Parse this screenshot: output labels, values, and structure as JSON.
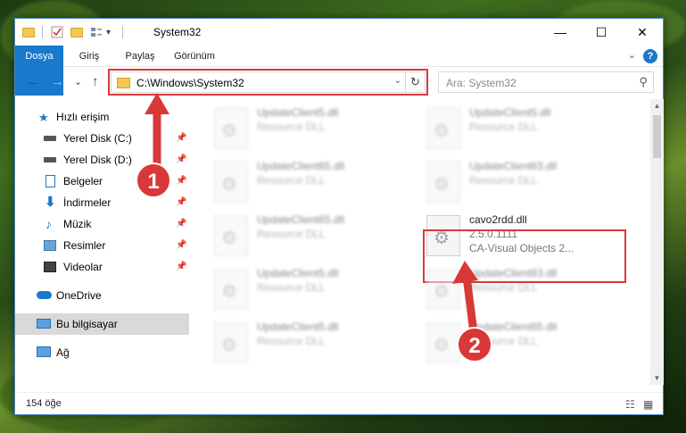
{
  "window": {
    "title": "System32"
  },
  "titlebar": {
    "minimize": "—",
    "maximize": "☐",
    "close": "✕"
  },
  "ribbon": {
    "tabs": [
      "Dosya",
      "Giriş",
      "Paylaş",
      "Görünüm"
    ],
    "help": "?"
  },
  "navigation": {
    "back": "←",
    "forward": "→",
    "recent": "⌄",
    "up": "↑",
    "address": "C:\\Windows\\System32",
    "refresh": "↻",
    "search_placeholder": "Ara: System32"
  },
  "sidebar": {
    "items": [
      {
        "label": "Hızlı erişim",
        "icon": "star-icon",
        "pinned": false
      },
      {
        "label": "Yerel Disk (C:)",
        "icon": "drive-icon",
        "pinned": true
      },
      {
        "label": "Yerel Disk (D:)",
        "icon": "drive-icon",
        "pinned": true
      },
      {
        "label": "Belgeler",
        "icon": "documents-icon",
        "pinned": true
      },
      {
        "label": "İndirmeler",
        "icon": "download-icon",
        "pinned": true
      },
      {
        "label": "Müzik",
        "icon": "music-icon",
        "pinned": true
      },
      {
        "label": "Resimler",
        "icon": "pictures-icon",
        "pinned": true
      },
      {
        "label": "Videolar",
        "icon": "videos-icon",
        "pinned": true
      },
      {
        "label": "OneDrive",
        "icon": "cloud-icon",
        "pinned": false
      },
      {
        "label": "Bu bilgisayar",
        "icon": "computer-icon",
        "pinned": false,
        "selected": true
      },
      {
        "label": "Ağ",
        "icon": "network-icon",
        "pinned": false
      }
    ]
  },
  "files": [
    {
      "name": "UpdateClient5.dll",
      "line2": "Resource DLL",
      "line3": ""
    },
    {
      "name": "UpdateClient5.dll",
      "line2": "Resource DLL",
      "line3": ""
    },
    {
      "name": "UpdateClient65.dll",
      "line2": "Resource DLL",
      "line3": ""
    },
    {
      "name": "UpdateClient63.dll",
      "line2": "Resource DLL",
      "line3": ""
    },
    {
      "name": "UpdateClient65.dll",
      "line2": "Resource DLL",
      "line3": ""
    },
    {
      "name": "cavo2rdd.dll",
      "line2": "2.5.0.1111",
      "line3": "CA-Visual Objects 2...",
      "highlighted": true
    },
    {
      "name": "UpdateClient5.dll",
      "line2": "Resource DLL",
      "line3": ""
    },
    {
      "name": "UpdateClient63.dll",
      "line2": "Resource DLL",
      "line3": ""
    },
    {
      "name": "UpdateClient5.dll",
      "line2": "Resource DLL",
      "line3": ""
    },
    {
      "name": "UpdateClient65.dll",
      "line2": "Resource DLL",
      "line3": ""
    }
  ],
  "status": {
    "count": "154 öğe"
  },
  "annotations": {
    "step1": "1",
    "step2": "2"
  },
  "colors": {
    "accent": "#1979ca",
    "highlight": "#d93838",
    "folder": "#f3c94f"
  }
}
